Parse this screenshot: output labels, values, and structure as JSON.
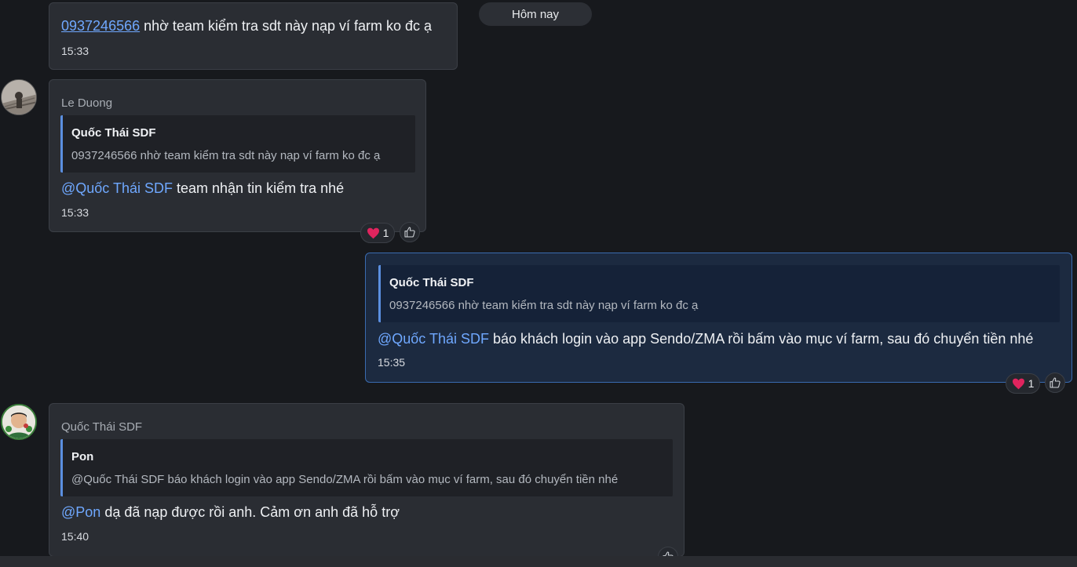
{
  "date_divider": "Hôm nay",
  "messages": [
    {
      "link": "0937246566",
      "text": " nhờ team kiểm tra sdt này nạp ví farm ko đc ạ",
      "time": "15:33"
    },
    {
      "sender": "Le Duong",
      "quote_author": "Quốc Thái SDF",
      "quote_text": "0937246566 nhờ team kiểm tra sdt này nạp ví farm ko đc ạ",
      "mention": "@Quốc Thái SDF",
      "text": " team nhận tin kiểm tra nhé",
      "time": "15:33",
      "reaction_count": "1"
    },
    {
      "quote_author": "Quốc Thái SDF",
      "quote_text": "0937246566 nhờ team kiểm tra sdt này nạp ví farm ko đc ạ",
      "mention": "@Quốc Thái SDF",
      "text": " báo khách login vào app Sendo/ZMA rồi bấm vào mục ví farm, sau đó chuyển tiền nhé",
      "time": "15:35",
      "reaction_count": "1"
    },
    {
      "sender": "Quốc Thái SDF",
      "quote_author": "Pon",
      "quote_text": "@Quốc Thái SDF báo khách login vào app Sendo/ZMA rồi bấm vào mục ví farm, sau đó chuyển tiền nhé",
      "mention": "@Pon",
      "text": " dạ đã nạp được rồi anh. Cảm ơn anh đã hỗ trợ",
      "time": "15:40"
    }
  ],
  "colors": {
    "background": "#17191d",
    "bubble": "#2a2d33",
    "own_bubble": "#1c2a40",
    "accent": "#6fa8ff",
    "heart": "#e0245e"
  },
  "icons": [
    "heart-icon",
    "thumbs-up-icon"
  ]
}
